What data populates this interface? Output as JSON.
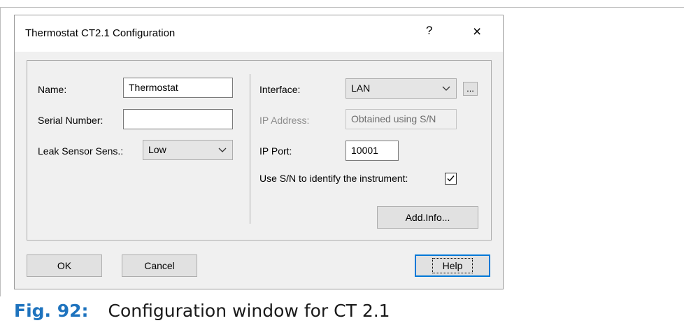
{
  "dialog": {
    "title": "Thermostat CT2.1 Configuration",
    "help_glyph": "?",
    "close_glyph": "×"
  },
  "left": {
    "name_label": "Name:",
    "name_value": "Thermostat",
    "serial_label": "Serial Number:",
    "serial_value": "",
    "leak_label": "Leak Sensor Sens.:",
    "leak_value": "Low"
  },
  "right": {
    "interface_label": "Interface:",
    "interface_value": "LAN",
    "dots_label": "...",
    "ip_address_label": "IP Address:",
    "ip_address_value": "Obtained using S/N",
    "ip_port_label": "IP Port:",
    "ip_port_value": "10001",
    "use_sn_label": "Use S/N to identify the instrument:",
    "use_sn_checked": true,
    "add_info_label": "Add.Info..."
  },
  "buttons": {
    "ok": "OK",
    "cancel": "Cancel",
    "help": "Help"
  },
  "caption": {
    "fig_label": "Fig. 92:",
    "text": "Configuration window for CT 2.1"
  },
  "icons": {
    "chevron": "chevron-down-icon",
    "check": "check-icon"
  }
}
